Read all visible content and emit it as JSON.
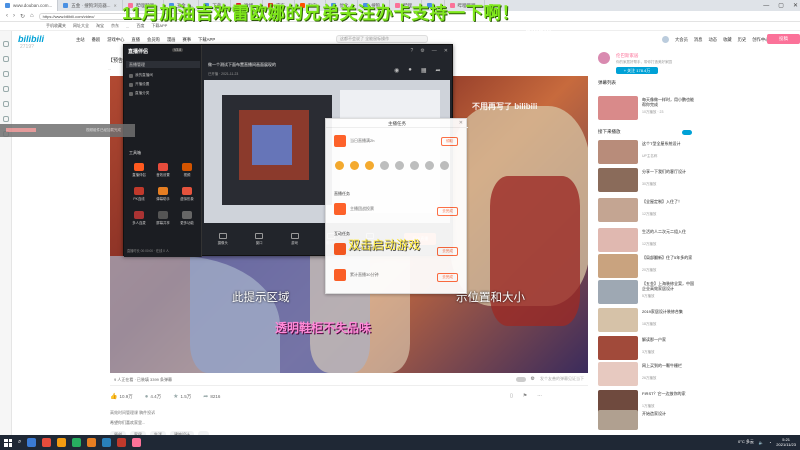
{
  "browser": {
    "tabs": [
      {
        "label": "www.douban.com..."
      },
      {
        "label": "五金 · 搜狗浏览器..."
      },
      {
        "label": "哔哩哔哩..."
      },
      {
        "label": "五金 · ..."
      },
      {
        "label": "下载..."
      },
      {
        "label": "微博..."
      },
      {
        "label": "京东..."
      },
      {
        "label": "淘宝..."
      },
      {
        "label": "优化..."
      },
      {
        "label": "搜狗..."
      },
      {
        "label": "哔哩..."
      },
      {
        "label": "..."
      },
      {
        "label": "哔哩哔哩..."
      }
    ],
    "url": "https://www.bilibili.com/video/",
    "bookmarks": [
      "手机收藏夹",
      "网址大全",
      "淘宝",
      "京东",
      "...",
      "百度",
      "下载APP"
    ],
    "window_controls": [
      "—",
      "▢",
      "✕"
    ]
  },
  "bili_header": {
    "logo": "bilibili",
    "nav": [
      "主站",
      "番剧",
      "游戏中心",
      "直播",
      "会员购",
      "漫画",
      "赛事",
      "下载APP"
    ],
    "search_placeholder": "这都不会说了 全能鼠标操作",
    "right": [
      "大会员",
      "消息",
      "动态",
      "收藏",
      "历史",
      "创作中心"
    ],
    "upload": "投稿",
    "counter": "2719?"
  },
  "video": {
    "title": "【预告】...",
    "meta": "...",
    "watermark": "bilibili",
    "player_watermark": "不用再写了 bilibili",
    "hint_left": "此提示区域",
    "hint_right": "示位置和大小",
    "pink_caption": "透明鞋柜不失品味",
    "bottom_left": "9 人正在看 · 已装填 3399 条弹幕",
    "danmaku_hint": "发个友善的弹幕见证当下",
    "like": "10.9万",
    "coin": "4.4万",
    "fav": "1.5万",
    "share": "8216",
    "desc1": "高效时间管理课 稿件投诉",
    "desc2": "希望你们喜欢家里...",
    "tags": [
      "原创",
      "家居",
      "生活",
      "建筑设计",
      "..."
    ]
  },
  "sidebar": {
    "up_name": "伦巴斯家居",
    "up_desc": "你的家居好帮手，带你打造美好家园",
    "follow": "+ 关注 178.4万",
    "section_title": "弹幕列表",
    "autoplay": "接下来播放",
    "recos": [
      {
        "title": "每天像做一样时，用小鹏也能帮你完成",
        "meta": "10万播放 · 23"
      },
      {
        "title": "这个T型全屋系统设计",
        "meta": "UP主名称"
      },
      {
        "title": "分享一下我们的客厅设计",
        "meta": "30万播放"
      },
      {
        "title": "【全屋定制】入住了！",
        "meta": "12万播放"
      },
      {
        "title": "生活的人二次元二组入住",
        "meta": "12万播放"
      },
      {
        "title": "【局部翻新】住了5年多的家",
        "meta": "20万播放"
      },
      {
        "title": "【五金】上海装修全案，中国企业高效家居设计",
        "meta": "5万播放"
      },
      {
        "title": "2019家居设计装修合集",
        "meta": "18万播放"
      },
      {
        "title": "解读那一户家",
        "meta": "3万播放"
      },
      {
        "title": "网上买到的一颗牛栅栏",
        "meta": "26万播放"
      },
      {
        "title": "FIRST？它一边放你的家",
        "meta": "1万播放"
      },
      {
        "title": "开始造家设计",
        "meta": "8万播放"
      }
    ]
  },
  "app": {
    "logo": "直播伴侣",
    "version": "V3.8",
    "sidebar_title": "直播管理",
    "entries": [
      "我的直播间",
      "开播设置",
      "直播分类"
    ],
    "tools_title": "工具箱",
    "tools": [
      "直播伴侣",
      "音效设置",
      "视频",
      "PK连线",
      "弹幕助手",
      "虚拟形象",
      "多人连麦",
      "屏幕共享",
      "更多功能"
    ],
    "status": "直播时长 00:00:00 · 在线 0 人",
    "title": "做一个测试下面布置直播间画面展现的",
    "subtitle": "已开播 · 2021-11-23",
    "bottom": [
      "摄像头",
      "窗口",
      "游戏",
      "素材库",
      "直播设置"
    ],
    "live_btn": "开始直播"
  },
  "panel": {
    "title": "主播任务",
    "item1": "当日直播满2h",
    "item1_btn": "领取",
    "sec2": "直播任务",
    "item2": "主播团战投票",
    "item2_btn": "去完成",
    "sec3": "互动任务",
    "item3": "双击启动游戏",
    "item3_btn": "去完成",
    "item4": "累计直播30分钟",
    "item4_btn": "去完成",
    "dbl_start": "双击启动游戏"
  },
  "banner": "11月加油吉欢雷欧娜的兄弟关注办卡支持一下啊！",
  "dimbar": {
    "a": "...",
    "b": "视频组件已经加载完成"
  },
  "taskbar": {
    "search_icon": "search-icon",
    "temp": "0°C 多云",
    "time": "5:21",
    "date": "2021/11/23"
  },
  "colors": {
    "bili_blue": "#00a1d6",
    "bili_pink": "#fb7299",
    "banner_green": "#7fe81c",
    "accent_orange": "#ff6a3d"
  }
}
